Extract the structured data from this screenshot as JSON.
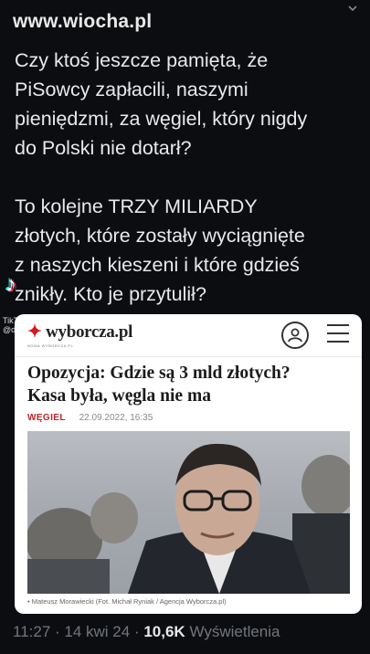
{
  "watermark": "www.wiocha.pl",
  "tweet": {
    "paragraph1": "Czy ktoś jeszcze pamięta, że\nPiSowcy zapłacili, naszymi\npieniędzmi, za węgiel, który nigdy\ndo Polski nie dotarł?",
    "paragraph2": "To kolejne TRZY MILIARDY\nzłotych, które zostały wyciągnięte\nz naszych kieszeni i które gdzieś\nznikły. Kto je przytulił?"
  },
  "tiktok": {
    "name": "TikTok",
    "handle": "@d"
  },
  "article": {
    "logo": "wyborcza.pl",
    "logo_sub": "NOWA WYBORCZA.PL",
    "headline_line1": "Opozycja: Gdzie są 3 mld złotych?",
    "headline_line2": "Kasa była, węgla nie ma",
    "section": "WĘGIEL",
    "date": "22.09.2022, 16:35",
    "caption": "• Mateusz Morawiecki (Fot. Michał Ryniak / Agencja Wyborcza.pl)"
  },
  "footer": {
    "time": "11:27",
    "sep": " · ",
    "date": "14 kwi 24",
    "views_count": "10,6K",
    "views_label": "Wyświetlenia"
  }
}
